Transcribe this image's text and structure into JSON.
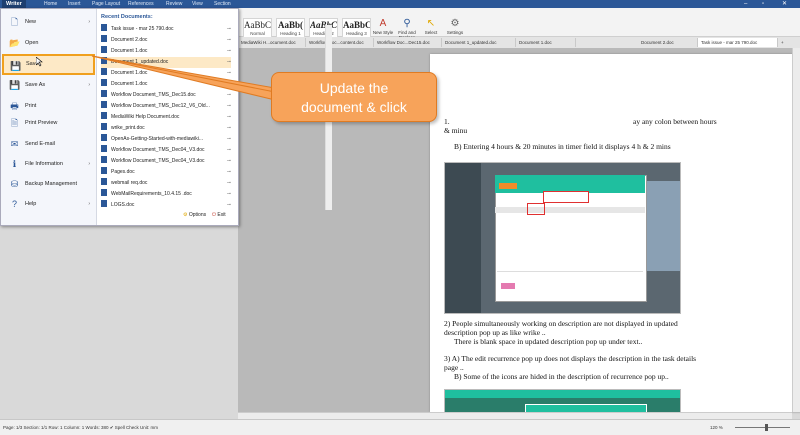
{
  "menubar": {
    "app": "Writer",
    "items": [
      "Home",
      "Insert",
      "Page Layout",
      "References",
      "Review",
      "View",
      "Section"
    ]
  },
  "ribbon": {
    "styles": [
      {
        "sample": "AaBbCcI",
        "caption": "Normal"
      },
      {
        "sample": "AaBb(",
        "caption": "Heading 1"
      },
      {
        "sample": "AaBbC",
        "caption": "Heading 2"
      },
      {
        "sample": "AaBbCc",
        "caption": "Heading 3"
      }
    ],
    "buttons": [
      {
        "icon": "A",
        "label": "New Style"
      },
      {
        "icon": "⚲",
        "label": "Find and Replace"
      },
      {
        "icon": "↖",
        "label": "Select"
      },
      {
        "icon": "⚙",
        "label": "Settings"
      }
    ]
  },
  "tabs": [
    "MediaWiki H...ocument.doc",
    "Workflow Doc...content.doc",
    "Workflow Doc...Dec15.doc",
    "Document 1_updated.doc",
    "Document 1.doc",
    "Document 2.doc",
    "Task issue - mar 25 790.doc"
  ],
  "file_menu": {
    "items": [
      {
        "label": "New",
        "icon": "🗋",
        "arrow": "›"
      },
      {
        "label": "Open",
        "icon": "📂",
        "arrow": ""
      },
      {
        "label": "Save",
        "icon": "💾",
        "arrow": ""
      },
      {
        "label": "Save As",
        "icon": "💾",
        "arrow": "›"
      },
      {
        "label": "Print",
        "icon": "🖶",
        "arrow": ""
      },
      {
        "label": "Print Preview",
        "icon": "🗎",
        "arrow": ""
      },
      {
        "label": "Send E-mail",
        "icon": "✉",
        "arrow": ""
      },
      {
        "label": "File Information",
        "icon": "ℹ",
        "arrow": "›"
      },
      {
        "label": "Backup Management",
        "icon": "⛁",
        "arrow": ""
      },
      {
        "label": "Help",
        "icon": "?",
        "arrow": "›"
      }
    ],
    "recent_title": "Recent Documents:",
    "recent": [
      "Task issue - mar 25 790.doc",
      "Document 2.doc",
      "Document 1.doc",
      "Document 1_updated.doc",
      "Document 1.doc",
      "Document 1.doc",
      "Workflow Document_TMS_Dec15.doc",
      "Workflow Document_TMS_Dec12_V6_Old...",
      "MediaWiki Help Document.doc",
      "wrike_print.doc",
      "OpenAs-Getting-Started-with-mediawiki...",
      "Workflow Document_TMS_Dec04_V3.doc",
      "Workflow Document_TMS_Dec04_V3.doc",
      "Pages.doc",
      "webmail req.doc",
      "WebMailRequirements_10.4.15 .doc",
      "LOGS.doc"
    ],
    "options_label": "Options",
    "exit_label": "Exit"
  },
  "callout": {
    "line1": "Update the",
    "line2": "document & click"
  },
  "document": {
    "p1_num": "1.",
    "p1a": "ay any colon between hours",
    "p1b": "& minu",
    "p1c": "B) Entering 4 hours & 20 minutes in timer field it displays 4 h & 2 mins",
    "p2a": "2)  People simultaneously working on description are not displayed in updated",
    "p2b": "description pop up as like wrike ..",
    "p2c": "There is blank space in updated description pop up under text..",
    "p3a": "3) A) The edit recurrence pop up does not displays the description in the task details",
    "p3b": "page ..",
    "p3c": "B) Some of the icons are hided in the description of recurrence pop up.."
  },
  "statusbar": {
    "left": "Page: 1/3  Section: 1/1  Row: 1  Column: 1  Words: 380  ✔ Spell Check  Unit: mm",
    "zoom": "120 %"
  },
  "colors": {
    "accent": "#2b5797",
    "callout": "#f7a35a",
    "highlight": "#f0a01e"
  }
}
